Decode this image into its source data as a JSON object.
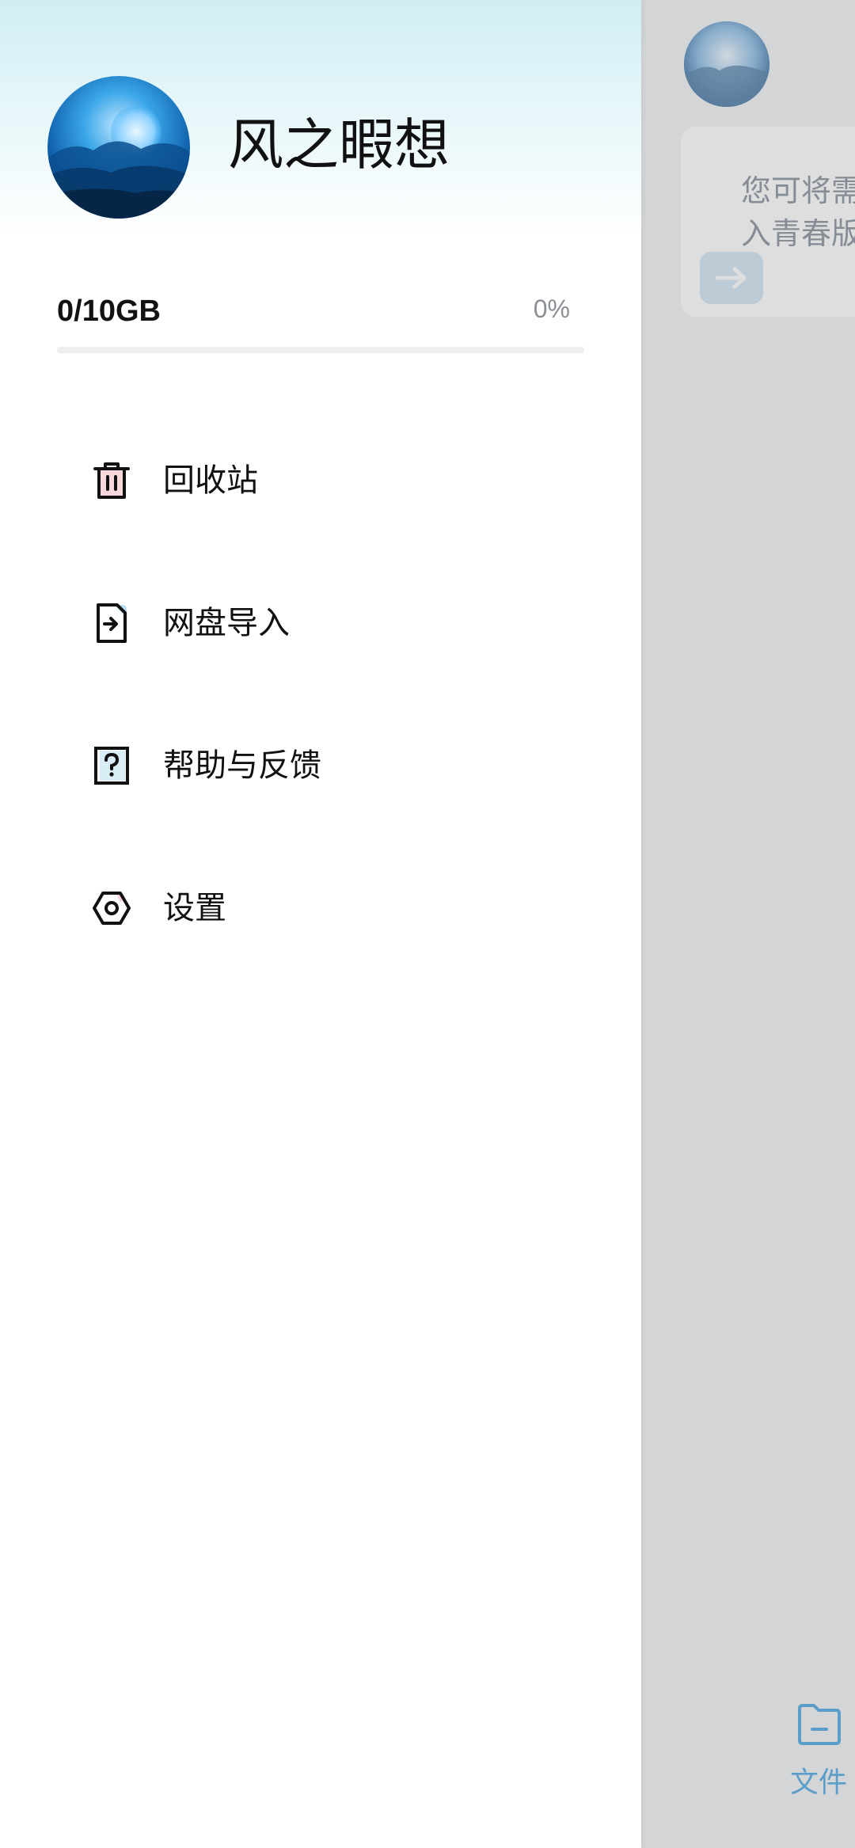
{
  "background": {
    "card_text": "您可将需入青春版",
    "card_text_lines": [
      "您可将需",
      "入青春版"
    ],
    "bottom_tab_label": "文件"
  },
  "drawer": {
    "username": "风之暇想",
    "storage": {
      "used_label": "0/10GB",
      "percent_label": "0%",
      "progress_fraction": 0
    },
    "menu": [
      {
        "label": "回收站",
        "icon": "trash-icon"
      },
      {
        "label": "网盘导入",
        "icon": "file-import-icon"
      },
      {
        "label": "帮助与反馈",
        "icon": "help-icon"
      },
      {
        "label": "设置",
        "icon": "settings-icon"
      }
    ]
  },
  "colors": {
    "accent": "#3aa3e0",
    "text_primary": "#111111",
    "text_secondary": "#8a8f95",
    "icon_pink": "#f3c7cc",
    "icon_blue": "#b9dff0"
  }
}
